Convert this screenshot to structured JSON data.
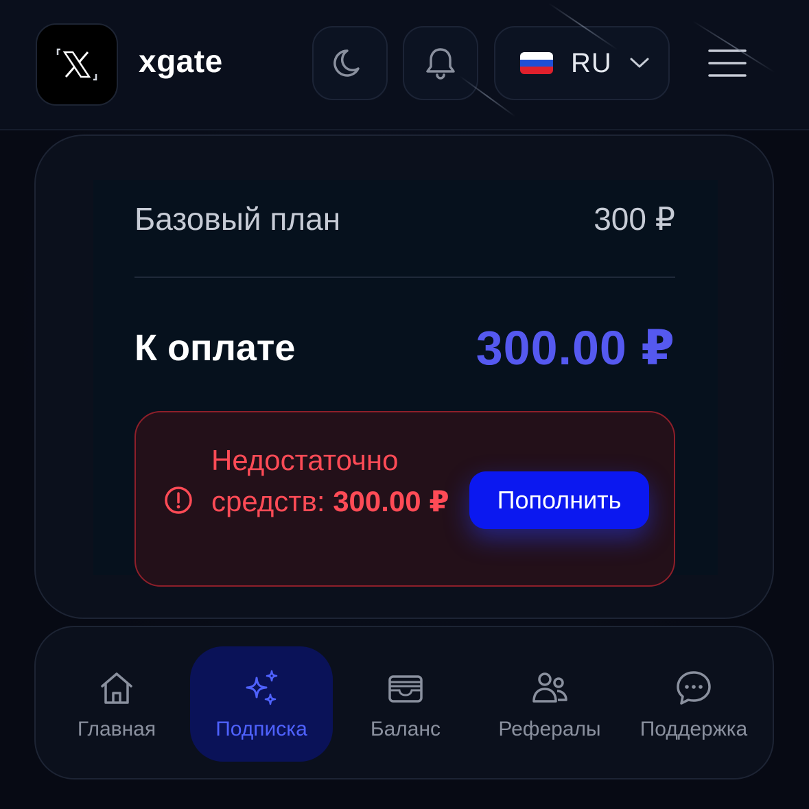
{
  "header": {
    "brand": "xgate",
    "language": {
      "code": "RU",
      "flag": "russian-flag-icon"
    },
    "buttons": [
      "moon-icon",
      "bell-icon",
      "menu-icon"
    ]
  },
  "plan": {
    "name": "Базовый план",
    "price": "300 ₽"
  },
  "payment": {
    "label": "К оплате",
    "amount": "300.00 ₽"
  },
  "alert": {
    "message": "Недостаточно средств:",
    "amount": "300.00 ₽",
    "button_label": "Пополнить"
  },
  "nav": {
    "items": [
      {
        "label": "Главная",
        "icon": "home-icon",
        "active": false
      },
      {
        "label": "Подписка",
        "icon": "sparkles-icon",
        "active": true
      },
      {
        "label": "Баланс",
        "icon": "wallet-icon",
        "active": false
      },
      {
        "label": "Рефералы",
        "icon": "users-icon",
        "active": false
      },
      {
        "label": "Поддержка",
        "icon": "chat-icon",
        "active": false
      }
    ]
  },
  "colors": {
    "accent": "#5559f0",
    "primary_button": "#0b18f0",
    "alert_text": "#ff4b56",
    "active_nav": "#4f62ff"
  }
}
